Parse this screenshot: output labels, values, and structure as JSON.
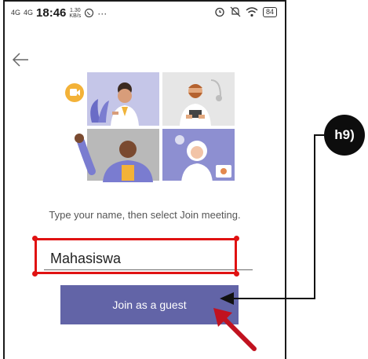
{
  "status_bar": {
    "signal1": "4G",
    "signal2": "4G",
    "time": "18:46",
    "net_speed": "1.30",
    "net_unit": "KB/s",
    "more": "···",
    "battery": "84"
  },
  "page": {
    "prompt": "Type your name, then select Join meeting.",
    "name_value": "Mahasiswa",
    "join_label": "Join as a guest"
  },
  "annotation": {
    "callout_label": "h9)",
    "highlight_color": "#e01212"
  },
  "colors": {
    "accent": "#6264a7"
  }
}
